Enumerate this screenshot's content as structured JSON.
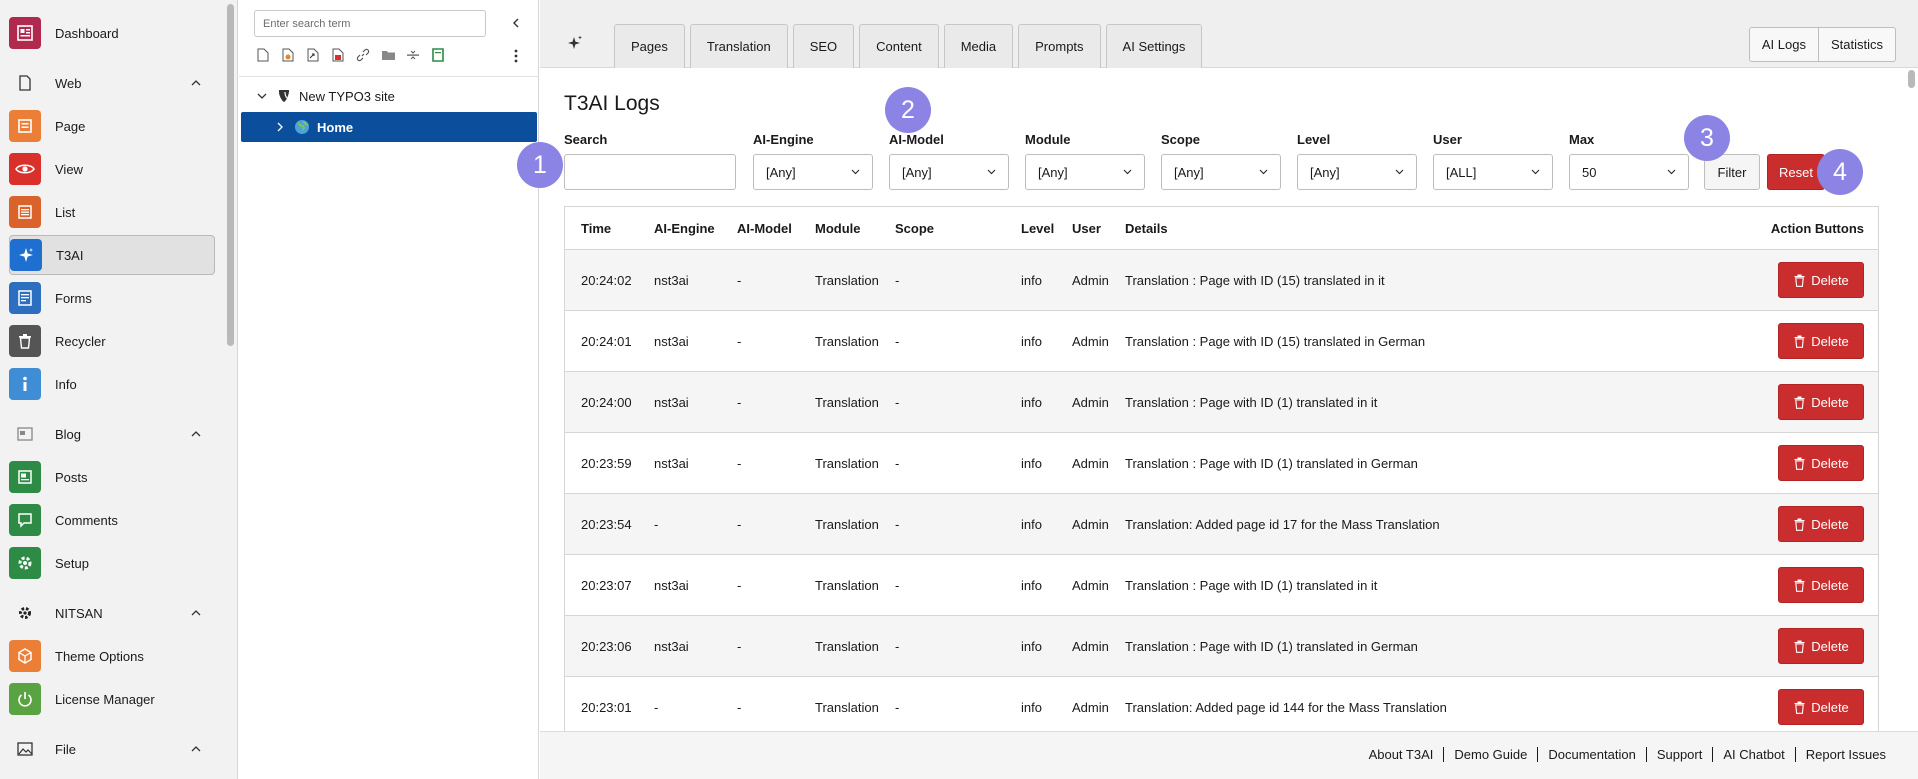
{
  "modmenu": {
    "items": [
      {
        "label": "Dashboard",
        "icon": "dashboard-icon",
        "color": "#b1294f"
      },
      {
        "label": "Page",
        "icon": "page-icon",
        "color": "#ec7f38"
      },
      {
        "label": "View",
        "icon": "eye-icon",
        "color": "#d9302b"
      },
      {
        "label": "List",
        "icon": "list-icon",
        "color": "#d9632b"
      },
      {
        "label": "T3AI",
        "icon": "sparkle-icon",
        "color": "#1e6fd0"
      },
      {
        "label": "Forms",
        "icon": "form-icon",
        "color": "#2c6fc0"
      },
      {
        "label": "Recycler",
        "icon": "trash-icon",
        "color": "#555555"
      },
      {
        "label": "Info",
        "icon": "info-icon",
        "color": "#3f8dd5"
      },
      {
        "label": "Posts",
        "icon": "posts-icon",
        "color": "#2e8b45"
      },
      {
        "label": "Comments",
        "icon": "comments-icon",
        "color": "#2e8b45"
      },
      {
        "label": "Setup",
        "icon": "gear-icon",
        "color": "#2e8b45"
      },
      {
        "label": "Theme Options",
        "icon": "theme-icon",
        "color": "#ec7f38"
      },
      {
        "label": "License Manager",
        "icon": "power-icon",
        "color": "#5aa343"
      }
    ],
    "groups": [
      {
        "label": "Web",
        "icon": "document-icon"
      },
      {
        "label": "Blog",
        "icon": "blog-icon"
      },
      {
        "label": "NITSAN",
        "icon": "gear-icon"
      },
      {
        "label": "File",
        "icon": "image-icon"
      }
    ]
  },
  "pagetree": {
    "search_placeholder": "Enter search term",
    "nodes": [
      {
        "label": "New TYPO3 site"
      },
      {
        "label": "Home"
      }
    ]
  },
  "header": {
    "tabs": [
      "Pages",
      "Translation",
      "SEO",
      "Content",
      "Media",
      "Prompts",
      "AI Settings"
    ],
    "right_buttons": [
      "AI Logs",
      "Statistics"
    ]
  },
  "page": {
    "title": "T3AI Logs"
  },
  "filters": {
    "search_label": "Search",
    "search_value": "",
    "fields": [
      {
        "label": "AI-Engine",
        "value": "[Any]"
      },
      {
        "label": "AI-Model",
        "value": "[Any]"
      },
      {
        "label": "Module",
        "value": "[Any]"
      },
      {
        "label": "Scope",
        "value": "[Any]"
      },
      {
        "label": "Level",
        "value": "[Any]"
      },
      {
        "label": "User",
        "value": "[ALL]"
      },
      {
        "label": "Max",
        "value": "50"
      }
    ],
    "filter_label": "Filter",
    "reset_label": "Reset"
  },
  "markers": [
    "1",
    "2",
    "3",
    "4"
  ],
  "table": {
    "columns": [
      "Time",
      "AI-Engine",
      "AI-Model",
      "Module",
      "Scope",
      "Level",
      "User",
      "Details",
      "Action Buttons"
    ],
    "delete_label": "Delete",
    "rows": [
      {
        "time": "20:24:02",
        "engine": "nst3ai",
        "model": "-",
        "module": "Translation",
        "scope": "-",
        "level": "info",
        "user": "Admin",
        "details": "Translation : Page with ID (15) translated in it"
      },
      {
        "time": "20:24:01",
        "engine": "nst3ai",
        "model": "-",
        "module": "Translation",
        "scope": "-",
        "level": "info",
        "user": "Admin",
        "details": "Translation : Page with ID (15) translated in German"
      },
      {
        "time": "20:24:00",
        "engine": "nst3ai",
        "model": "-",
        "module": "Translation",
        "scope": "-",
        "level": "info",
        "user": "Admin",
        "details": "Translation : Page with ID (1) translated in it"
      },
      {
        "time": "20:23:59",
        "engine": "nst3ai",
        "model": "-",
        "module": "Translation",
        "scope": "-",
        "level": "info",
        "user": "Admin",
        "details": "Translation : Page with ID (1) translated in German"
      },
      {
        "time": "20:23:54",
        "engine": "-",
        "model": "-",
        "module": "Translation",
        "scope": "-",
        "level": "info",
        "user": "Admin",
        "details": "Translation: Added page id 17 for the Mass Translation"
      },
      {
        "time": "20:23:07",
        "engine": "nst3ai",
        "model": "-",
        "module": "Translation",
        "scope": "-",
        "level": "info",
        "user": "Admin",
        "details": "Translation : Page with ID (1) translated in it"
      },
      {
        "time": "20:23:06",
        "engine": "nst3ai",
        "model": "-",
        "module": "Translation",
        "scope": "-",
        "level": "info",
        "user": "Admin",
        "details": "Translation : Page with ID (1) translated in German"
      },
      {
        "time": "20:23:01",
        "engine": "-",
        "model": "-",
        "module": "Translation",
        "scope": "-",
        "level": "info",
        "user": "Admin",
        "details": "Translation: Added page id 144 for the Mass Translation"
      }
    ]
  },
  "footer": {
    "links": [
      "About T3AI",
      "Demo Guide",
      "Documentation",
      "Support",
      "AI Chatbot",
      "Report Issues"
    ]
  }
}
